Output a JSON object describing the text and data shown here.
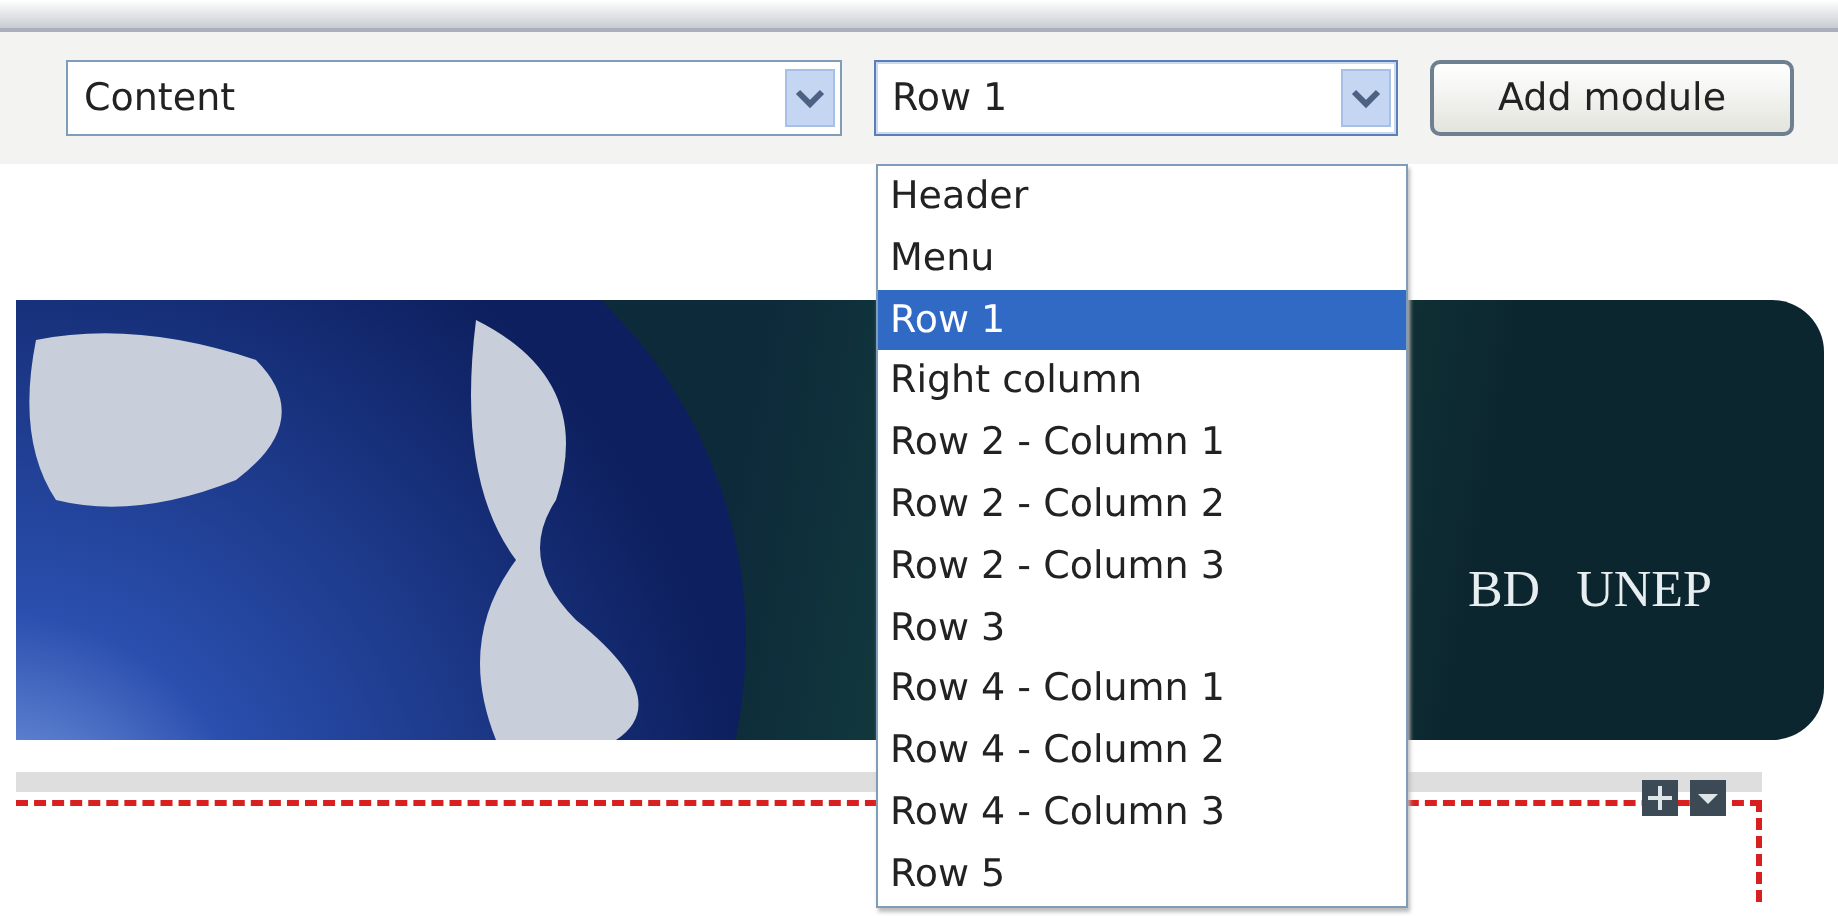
{
  "toolbar": {
    "area_select": {
      "value": "Content"
    },
    "position_select": {
      "value": "Row 1",
      "expanded": true,
      "options": [
        {
          "label": "Header",
          "selected": false
        },
        {
          "label": "Menu",
          "selected": false
        },
        {
          "label": "Row 1",
          "selected": true
        },
        {
          "label": "Right column",
          "selected": false
        },
        {
          "label": "Row 2 - Column 1",
          "selected": false
        },
        {
          "label": "Row 2 - Column 2",
          "selected": false
        },
        {
          "label": "Row 2 - Column 3",
          "selected": false
        },
        {
          "label": "Row 3",
          "selected": false
        },
        {
          "label": "Row 4 - Column 1",
          "selected": false
        },
        {
          "label": "Row 4 - Column 2",
          "selected": false
        },
        {
          "label": "Row 4 - Column 3",
          "selected": false
        },
        {
          "label": "Row 5",
          "selected": false
        }
      ]
    },
    "add_button": "Add module"
  },
  "banner": {
    "logos": [
      "BD",
      "UNEP"
    ]
  }
}
